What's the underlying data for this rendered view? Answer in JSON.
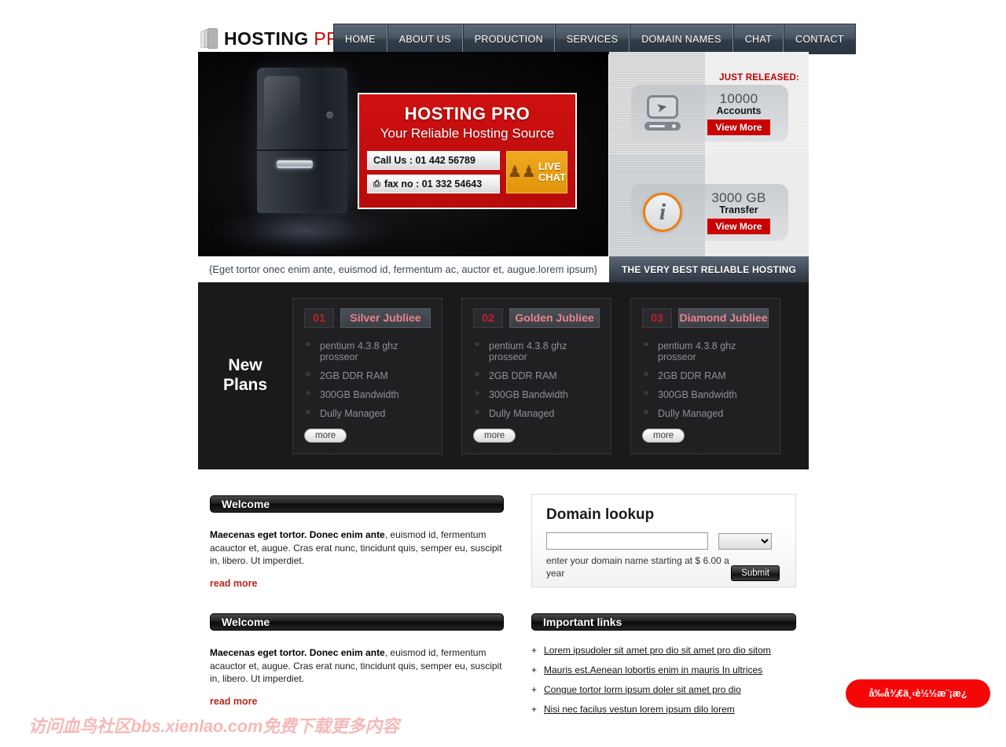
{
  "header": {
    "logo_text": "HOSTING",
    "logo_accent": "PRO",
    "nav": [
      {
        "label": "HOME"
      },
      {
        "label": "ABOUT US"
      },
      {
        "label": "PRODUCTION"
      },
      {
        "label": "SERVICES"
      },
      {
        "label": "DOMAIN NAMES"
      },
      {
        "label": "CHAT"
      },
      {
        "label": "CONTACT"
      }
    ]
  },
  "hero": {
    "title": "HOSTING PRO",
    "subtitle": "Your Reliable Hosting Source",
    "phone": "Call Us : 01 442 56789",
    "fax": "fax no : 01 332 54643",
    "chat_line1": "LIVE",
    "chat_line2": "CHAT",
    "caption": "{Eget tortor onec enim ante, euismod id, fermentum ac, auctor et, augue.lorem ipsum}",
    "tagline": "THE VERY BEST RELIABLE HOSTING"
  },
  "promo": {
    "just_released": "JUST RELEASED:",
    "cards": [
      {
        "number": "10000",
        "unit": "Accounts",
        "button": "View More",
        "icon": "monitor-cursor-icon"
      },
      {
        "number": "3000 GB",
        "unit": "Transfer",
        "button": "View More",
        "icon": "info-circle-icon"
      }
    ]
  },
  "plans": {
    "title_line1": "New",
    "title_line2": "Plans",
    "items": [
      {
        "number": "01",
        "name": "Silver Jubliee",
        "features": [
          "pentium 4.3.8 ghz prosseor",
          "2GB DDR RAM",
          "300GB Bandwidth",
          "Dully Managed"
        ],
        "more_label": "more"
      },
      {
        "number": "02",
        "name": "Golden Jubliee",
        "features": [
          "pentium 4.3.8 ghz prosseor",
          "2GB DDR RAM",
          "300GB Bandwidth",
          "Dully Managed"
        ],
        "more_label": "more"
      },
      {
        "number": "03",
        "name": "Diamond Jubliee",
        "features": [
          "pentium 4.3.8 ghz prosseor",
          "2GB DDR RAM",
          "300GB Bandwidth",
          "Dully Managed"
        ],
        "more_label": "more"
      }
    ]
  },
  "welcome_1": {
    "heading": "Welcome",
    "lead": "Maecenas eget tortor. Donec enim ante",
    "body": ", euismod id, fermentum acauctor et, augue. Cras erat nunc, tincidunt quis, semper eu, suscipit in, libero. Ut imperdiet.",
    "read_more": "read more"
  },
  "welcome_2": {
    "heading": "Welcome",
    "lead": "Maecenas eget tortor. Donec enim ante",
    "body": ", euismod id, fermentum acauctor et, augue. Cras erat nunc, tincidunt quis, semper eu, suscipit in, libero. Ut imperdiet.",
    "read_more": "read more"
  },
  "lookup": {
    "title": "Domain lookup",
    "input_value": "",
    "input_placeholder": "",
    "tld_selected": "",
    "hint": "enter your domain name starting at $ 6.00 a year",
    "submit_label": "Submit"
  },
  "links": {
    "heading": "Important links",
    "bullet": "+",
    "items": [
      {
        "label": "Lorem ipsudoler sit amet pro dio sit amet pro dio sitom"
      },
      {
        "label": "Mauris est.Aenean lobortis enim in mauris In ultrices"
      },
      {
        "label": "Congue tortor lorm ipsum doler sit amet pro dio"
      },
      {
        "label": "Nisi nec facilus vestun lorem ipsum dilo lorem"
      }
    ]
  },
  "overlay": {
    "watermark": "访问血鸟社区bbs.xienlao.com免费下载更多内容",
    "float_button": "å‰å¾€ä¸‹è½½æ¨¡æ¿"
  },
  "colors": {
    "accent_red": "#cc0000",
    "nav_dark": "#2b3441",
    "plans_bg": "#1a1a1c",
    "chat_orange": "#e0960c",
    "float_red": "#f50707"
  }
}
